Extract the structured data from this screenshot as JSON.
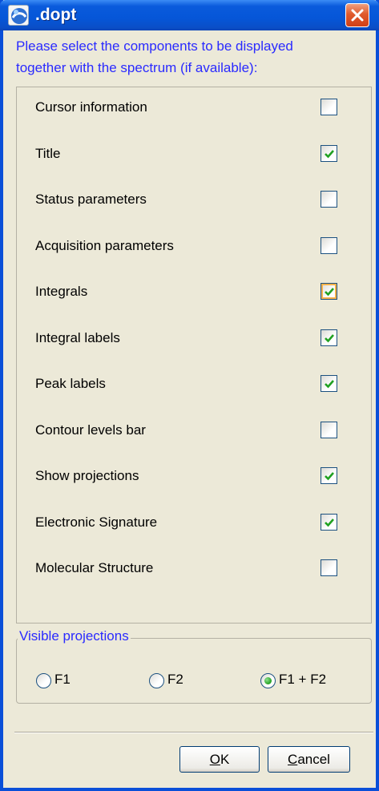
{
  "window": {
    "title": ".dopt",
    "icon": "app-logo-icon",
    "close_icon": "close-icon"
  },
  "intro_text_line1": "Please select the components to be displayed",
  "intro_text_line2": "together with the spectrum (if available):",
  "components": [
    {
      "label": "Cursor information",
      "checked": false
    },
    {
      "label": "Title",
      "checked": true
    },
    {
      "label": "Status parameters",
      "checked": false
    },
    {
      "label": "Acquisition parameters",
      "checked": false
    },
    {
      "label": "Integrals",
      "checked": true,
      "hover": true
    },
    {
      "label": "Integral labels",
      "checked": true
    },
    {
      "label": "Peak labels",
      "checked": true
    },
    {
      "label": "Contour levels bar",
      "checked": false
    },
    {
      "label": "Show projections",
      "checked": true
    },
    {
      "label": "Electronic Signature",
      "checked": true
    },
    {
      "label": "Molecular Structure",
      "checked": false
    }
  ],
  "projections": {
    "legend": "Visible projections",
    "options": [
      {
        "label": "F1",
        "selected": false
      },
      {
        "label": "F2",
        "selected": false
      },
      {
        "label": "F1 + F2",
        "selected": true
      }
    ]
  },
  "buttons": {
    "ok_mnemonic": "O",
    "ok_rest": "K",
    "cancel_mnemonic": "C",
    "cancel_rest": "ancel"
  },
  "colors": {
    "title_bar": "#0556d8",
    "accent_text": "#2a2aff",
    "check_mark": "#21a121",
    "close_button": "#e05a2c"
  }
}
